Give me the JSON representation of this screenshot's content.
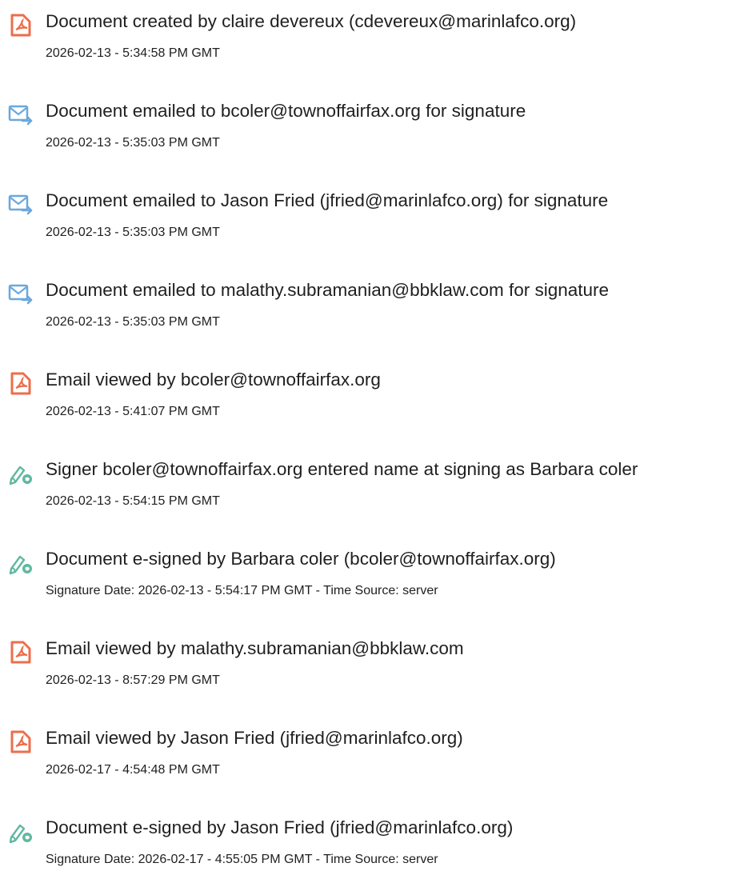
{
  "colors": {
    "acrobat_icon": "#ec6e4b",
    "email_icon": "#6aa8dd",
    "sign_icon": "#5fb8a0",
    "text": "#1f1f1f"
  },
  "events": [
    {
      "icon": "acrobat-document-icon",
      "title": "Document created by claire devereux (cdevereux@marinlafco.org)",
      "timestamp": "2026-02-13 - 5:34:58 PM GMT"
    },
    {
      "icon": "email-send-icon",
      "title": "Document emailed to bcoler@townoffairfax.org for signature",
      "timestamp": "2026-02-13 - 5:35:03 PM GMT"
    },
    {
      "icon": "email-send-icon",
      "title": "Document emailed to Jason Fried (jfried@marinlafco.org) for signature",
      "timestamp": "2026-02-13 - 5:35:03 PM GMT"
    },
    {
      "icon": "email-send-icon",
      "title": "Document emailed to malathy.subramanian@bbklaw.com for signature",
      "timestamp": "2026-02-13 - 5:35:03 PM GMT"
    },
    {
      "icon": "acrobat-document-icon",
      "title": "Email viewed by bcoler@townoffairfax.org",
      "timestamp": "2026-02-13 - 5:41:07 PM GMT"
    },
    {
      "icon": "e-sign-pen-icon",
      "title": "Signer bcoler@townoffairfax.org entered name at signing as Barbara coler",
      "timestamp": "2026-02-13 - 5:54:15 PM GMT"
    },
    {
      "icon": "e-sign-pen-icon",
      "title": "Document e-signed by Barbara coler (bcoler@townoffairfax.org)",
      "timestamp": "Signature Date: 2026-02-13 - 5:54:17 PM GMT - Time Source: server"
    },
    {
      "icon": "acrobat-document-icon",
      "title": "Email viewed by malathy.subramanian@bbklaw.com",
      "timestamp": "2026-02-13 - 8:57:29 PM GMT"
    },
    {
      "icon": "acrobat-document-icon",
      "title": "Email viewed by Jason Fried (jfried@marinlafco.org)",
      "timestamp": "2026-02-17 - 4:54:48 PM GMT"
    },
    {
      "icon": "e-sign-pen-icon",
      "title": "Document e-signed by Jason Fried (jfried@marinlafco.org)",
      "timestamp": "Signature Date: 2026-02-17 - 4:55:05 PM GMT - Time Source: server"
    }
  ]
}
